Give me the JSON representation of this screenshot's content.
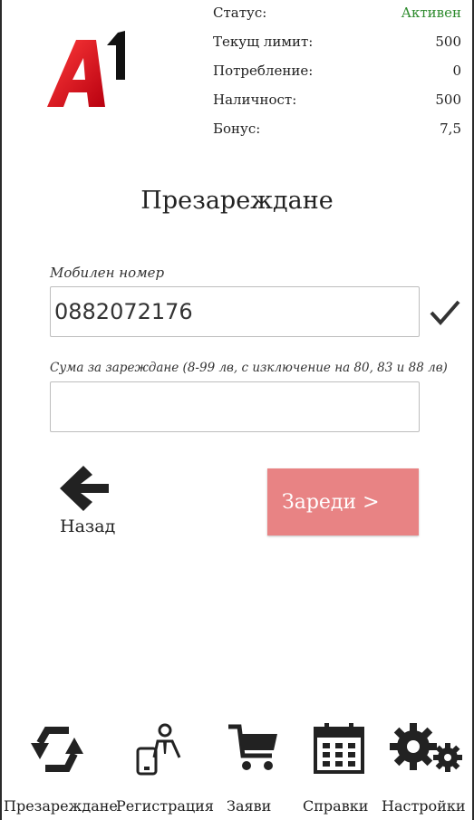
{
  "brand": {
    "logo_text": "A1",
    "accent": "#e4001b"
  },
  "status": {
    "rows": [
      {
        "label": "Статус:",
        "value": "Активен"
      },
      {
        "label": "Текущ лимит:",
        "value": "500"
      },
      {
        "label": "Потребление:",
        "value": "0"
      },
      {
        "label": "Наличност:",
        "value": "500"
      },
      {
        "label": "Бонус:",
        "value": "7,5"
      }
    ],
    "active_color": "#2e8b2e"
  },
  "page_title": "Презареждане",
  "form": {
    "phone_label": "Мобилен номер",
    "phone_value": "0882072176",
    "amount_label": "Сума за зареждане (8-99 лв, с изключение на 80, 83 и 88 лв)",
    "amount_value": ""
  },
  "actions": {
    "back_label": "Назад",
    "submit_label": "Зареди >",
    "submit_color": "#e88384"
  },
  "nav": [
    {
      "label": "Презареждане",
      "icon": "recharge-arrows-icon"
    },
    {
      "label": "Регистрация",
      "icon": "registration-person-icon"
    },
    {
      "label": "Заяви",
      "icon": "cart-icon"
    },
    {
      "label": "Справки",
      "icon": "calendar-icon"
    },
    {
      "label": "Настройки",
      "icon": "gears-icon"
    }
  ]
}
